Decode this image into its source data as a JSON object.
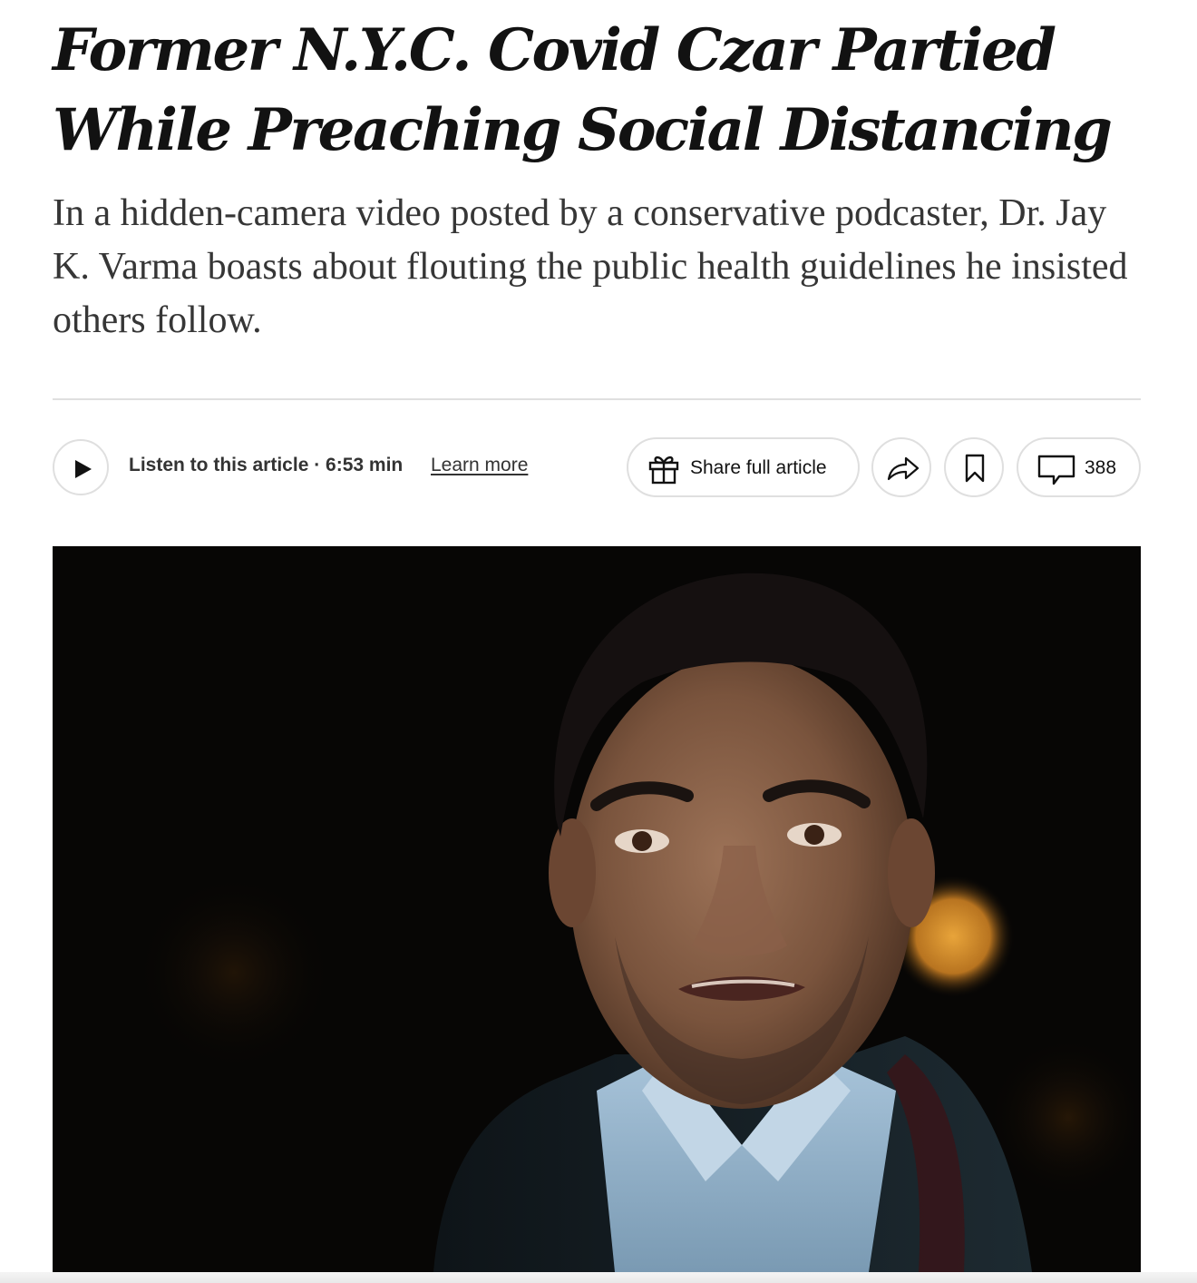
{
  "article": {
    "headline_line1": "Former N.Y.C. Covid Czar Partied",
    "headline_line2": "While Preaching Social Distancing",
    "summary": "In a hidden-camera video posted by a conservative podcaster, Dr. Jay K. Varma boasts about flouting the public health guidelines he insisted others follow."
  },
  "toolbar": {
    "listen_label": "Listen to this article · 6:53 min",
    "learn_more": "Learn more",
    "share_full_article": "Share full article",
    "comment_count": "388",
    "icons": [
      "play-icon",
      "gift-icon",
      "share-arrow-icon",
      "bookmark-icon",
      "comment-icon"
    ]
  }
}
